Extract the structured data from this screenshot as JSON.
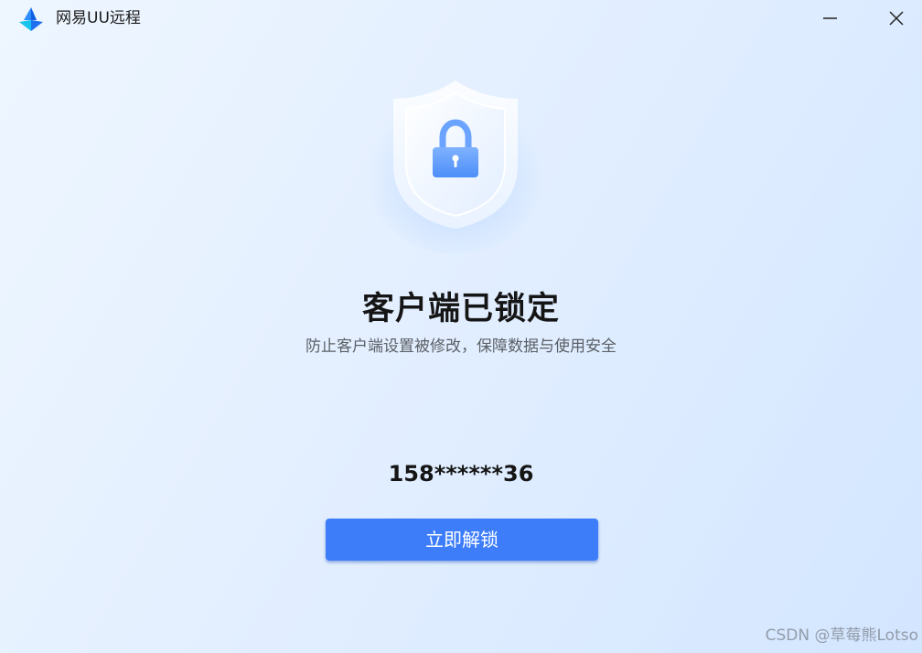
{
  "window": {
    "app_title": "网易UU远程",
    "logo_icon": "uu-remote-logo-icon",
    "minimize_icon": "minimize-icon",
    "close_icon": "close-icon"
  },
  "lock_screen": {
    "illustration_icon": "shield-lock-icon",
    "headline": "客户端已锁定",
    "subtitle": "防止客户端设置被修改，保障数据与使用安全",
    "account": "158******36",
    "unlock_label": "立即解锁"
  },
  "watermark": "CSDN @草莓熊Lotso",
  "colors": {
    "accent": "#3d7dfa",
    "background": "#e3efff",
    "headline_text": "#151515",
    "subtitle_text": "#5a5f66"
  }
}
